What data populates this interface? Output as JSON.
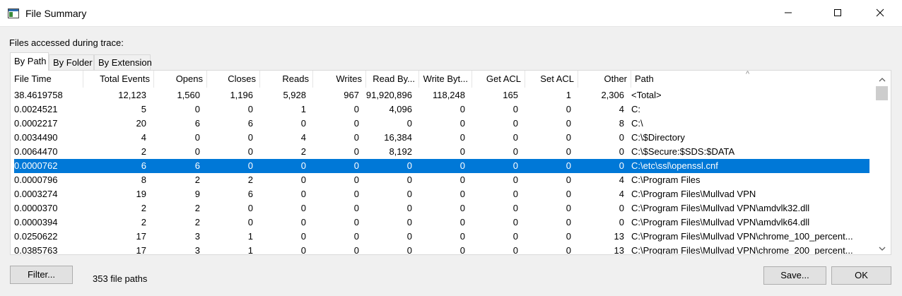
{
  "window": {
    "title": "File Summary",
    "icon": "window-app-icon"
  },
  "caption": "Files accessed during trace:",
  "tabs": [
    {
      "label": "By Path",
      "active": true
    },
    {
      "label": "By Folder",
      "active": false
    },
    {
      "label": "By Extension",
      "active": false
    }
  ],
  "columns": [
    "File Time",
    "Total Events",
    "Opens",
    "Closes",
    "Reads",
    "Writes",
    "Read By...",
    "Write Byt...",
    "Get ACL",
    "Set ACL",
    "Other",
    "Path"
  ],
  "rows": [
    [
      "38.4619758",
      "12,123",
      "1,560",
      "1,196",
      "5,928",
      "967",
      "91,920,896",
      "118,248",
      "165",
      "1",
      "2,306",
      "<Total>"
    ],
    [
      "0.0024521",
      "5",
      "0",
      "0",
      "1",
      "0",
      "4,096",
      "0",
      "0",
      "0",
      "4",
      "C:"
    ],
    [
      "0.0002217",
      "20",
      "6",
      "6",
      "0",
      "0",
      "0",
      "0",
      "0",
      "0",
      "8",
      "C:\\"
    ],
    [
      "0.0034490",
      "4",
      "0",
      "0",
      "4",
      "0",
      "16,384",
      "0",
      "0",
      "0",
      "0",
      "C:\\$Directory"
    ],
    [
      "0.0064470",
      "2",
      "0",
      "0",
      "2",
      "0",
      "8,192",
      "0",
      "0",
      "0",
      "0",
      "C:\\$Secure:$SDS:$DATA"
    ],
    [
      "0.0000762",
      "6",
      "6",
      "0",
      "0",
      "0",
      "0",
      "0",
      "0",
      "0",
      "0",
      "C:\\etc\\ssl\\openssl.cnf"
    ],
    [
      "0.0000796",
      "8",
      "2",
      "2",
      "0",
      "0",
      "0",
      "0",
      "0",
      "0",
      "4",
      "C:\\Program Files"
    ],
    [
      "0.0003274",
      "19",
      "9",
      "6",
      "0",
      "0",
      "0",
      "0",
      "0",
      "0",
      "4",
      "C:\\Program Files\\Mullvad VPN"
    ],
    [
      "0.0000370",
      "2",
      "2",
      "0",
      "0",
      "0",
      "0",
      "0",
      "0",
      "0",
      "0",
      "C:\\Program Files\\Mullvad VPN\\amdvlk32.dll"
    ],
    [
      "0.0000394",
      "2",
      "2",
      "0",
      "0",
      "0",
      "0",
      "0",
      "0",
      "0",
      "0",
      "C:\\Program Files\\Mullvad VPN\\amdvlk64.dll"
    ],
    [
      "0.0250622",
      "17",
      "3",
      "1",
      "0",
      "0",
      "0",
      "0",
      "0",
      "0",
      "13",
      "C:\\Program Files\\Mullvad VPN\\chrome_100_percent..."
    ],
    [
      "0.0385763",
      "17",
      "3",
      "1",
      "0",
      "0",
      "0",
      "0",
      "0",
      "0",
      "13",
      "C:\\Program Files\\Mullvad VPN\\chrome_200_percent..."
    ]
  ],
  "selected_row": 5,
  "sort_indicator": "^",
  "buttons": {
    "filter": "Filter...",
    "save": "Save...",
    "ok": "OK"
  },
  "status": "353 file paths",
  "colors": {
    "selection": "#0078d7",
    "background": "#f0f0f0"
  }
}
